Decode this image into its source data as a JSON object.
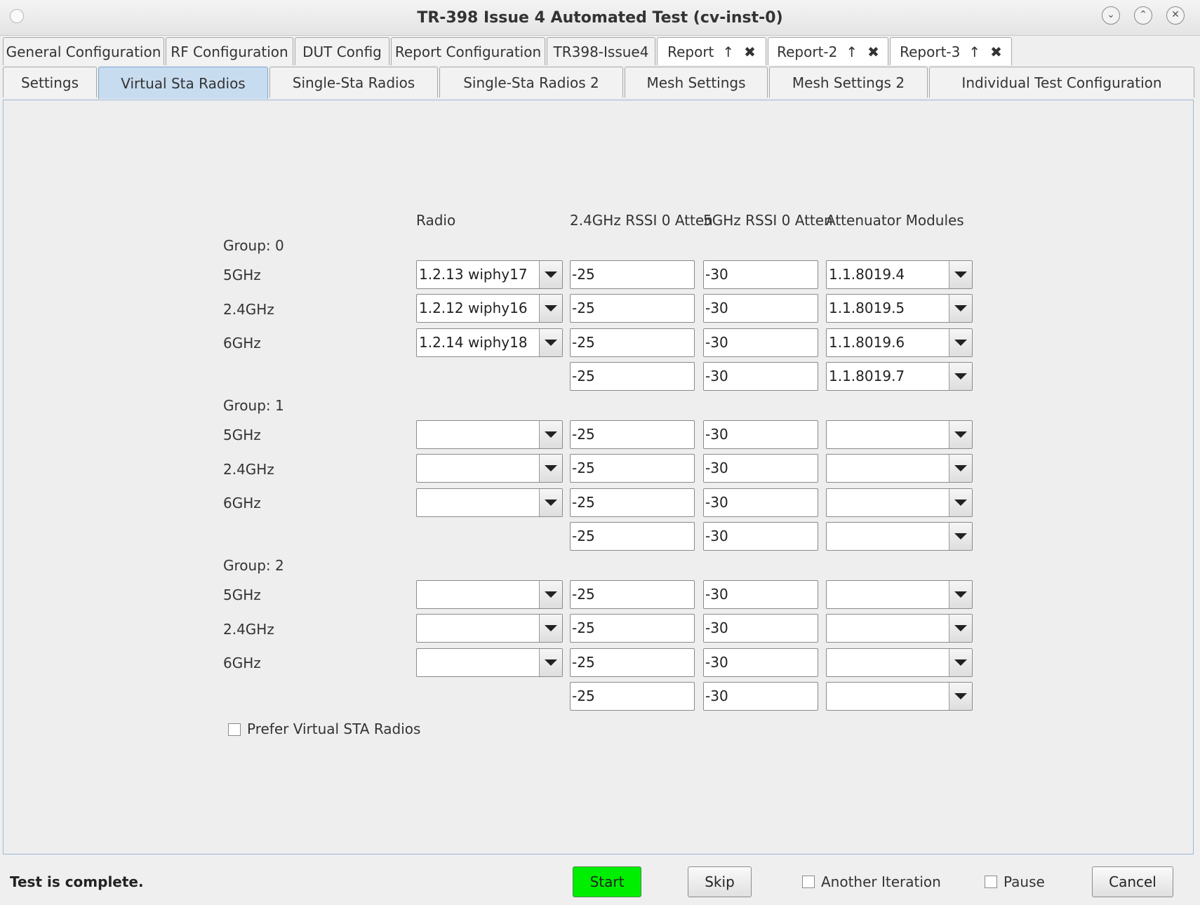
{
  "window": {
    "title": "TR-398 Issue 4 Automated Test  (cv-inst-0)",
    "buttons": [
      "minimize-icon",
      "maximize-icon",
      "close-icon"
    ]
  },
  "tabs_top": [
    {
      "label": "General Configuration"
    },
    {
      "label": "RF Configuration"
    },
    {
      "label": "DUT Config"
    },
    {
      "label": "Report Configuration"
    },
    {
      "label": "TR398-Issue4"
    },
    {
      "label": "Report",
      "up": "↑",
      "close": "✖"
    },
    {
      "label": "Report-2",
      "up": "↑",
      "close": "✖"
    },
    {
      "label": "Report-3",
      "up": "↑",
      "close": "✖"
    }
  ],
  "tabs_second": [
    {
      "label": "Settings"
    },
    {
      "label": "Virtual Sta Radios",
      "selected": true
    },
    {
      "label": "Single-Sta Radios"
    },
    {
      "label": "Single-Sta Radios 2"
    },
    {
      "label": "Mesh Settings"
    },
    {
      "label": "Mesh Settings 2"
    },
    {
      "label": "Individual Test Configuration"
    }
  ],
  "columns": {
    "radio": "Radio",
    "rssi24": "2.4GHz RSSI 0 Atten",
    "rssi5": "5GHz RSSI 0 Atten",
    "atten": "Attenuator Modules"
  },
  "groups": [
    {
      "label": "Group: 0",
      "rows": [
        {
          "band": "5GHz",
          "radio": "1.2.13 wiphy17",
          "rssi24": "-25",
          "rssi5": "-30",
          "atten": "1.1.8019.4"
        },
        {
          "band": "2.4GHz",
          "radio": "1.2.12 wiphy16",
          "rssi24": "-25",
          "rssi5": "-30",
          "atten": "1.1.8019.5"
        },
        {
          "band": "6GHz",
          "radio": "1.2.14 wiphy18",
          "rssi24": "-25",
          "rssi5": "-30",
          "atten": "1.1.8019.6"
        },
        {
          "band": "",
          "radio": null,
          "rssi24": "-25",
          "rssi5": "-30",
          "atten": "1.1.8019.7"
        }
      ]
    },
    {
      "label": "Group: 1",
      "rows": [
        {
          "band": "5GHz",
          "radio": "",
          "rssi24": "-25",
          "rssi5": "-30",
          "atten": ""
        },
        {
          "band": "2.4GHz",
          "radio": "",
          "rssi24": "-25",
          "rssi5": "-30",
          "atten": ""
        },
        {
          "band": "6GHz",
          "radio": "",
          "rssi24": "-25",
          "rssi5": "-30",
          "atten": ""
        },
        {
          "band": "",
          "radio": null,
          "rssi24": "-25",
          "rssi5": "-30",
          "atten": ""
        }
      ]
    },
    {
      "label": "Group: 2",
      "rows": [
        {
          "band": "5GHz",
          "radio": "",
          "rssi24": "-25",
          "rssi5": "-30",
          "atten": ""
        },
        {
          "band": "2.4GHz",
          "radio": "",
          "rssi24": "-25",
          "rssi5": "-30",
          "atten": ""
        },
        {
          "band": "6GHz",
          "radio": "",
          "rssi24": "-25",
          "rssi5": "-30",
          "atten": ""
        },
        {
          "band": "",
          "radio": null,
          "rssi24": "-25",
          "rssi5": "-30",
          "atten": ""
        }
      ]
    }
  ],
  "prefer_virtual": {
    "label": "Prefer Virtual STA Radios",
    "checked": false
  },
  "bottom": {
    "status": "Test is complete.",
    "start": "Start",
    "skip": "Skip",
    "another_iteration": "Another Iteration",
    "pause": "Pause",
    "cancel": "Cancel"
  },
  "colors": {
    "start_button": "#00ee00",
    "selected_tab": "#c8dcf0"
  }
}
